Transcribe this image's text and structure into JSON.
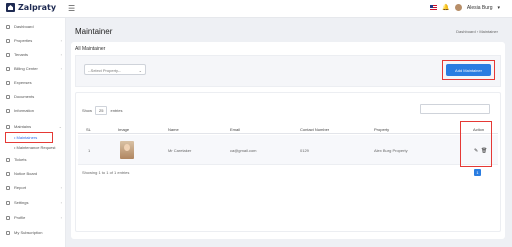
{
  "app": {
    "name": "Zalpraty"
  },
  "topbar": {
    "menu_icon": "hamburger-icon",
    "user": "Alesia Burg",
    "dropdown": "▾"
  },
  "sidebar": {
    "items": [
      {
        "label": "Dashboard",
        "icon": "dashboard-icon"
      },
      {
        "label": "Properties",
        "icon": "building-icon",
        "chevron": "›"
      },
      {
        "label": "Tenants",
        "icon": "users-icon",
        "chevron": "›"
      },
      {
        "label": "Billing Center",
        "icon": "billing-icon",
        "chevron": "›"
      },
      {
        "label": "Expenses",
        "icon": "wallet-icon"
      },
      {
        "label": "Documents",
        "icon": "document-icon"
      },
      {
        "label": "Information",
        "icon": "info-icon"
      },
      {
        "label": "Maintains",
        "icon": "wrench-icon",
        "chevron": "⌄"
      },
      {
        "label": "Tickets",
        "icon": "ticket-icon"
      },
      {
        "label": "Notice Board",
        "icon": "notice-icon"
      },
      {
        "label": "Report",
        "icon": "report-icon",
        "chevron": "›"
      },
      {
        "label": "Settings",
        "icon": "gear-icon",
        "chevron": "›"
      },
      {
        "label": "Profile",
        "icon": "profile-icon",
        "chevron": "›"
      },
      {
        "label": "My Subscription",
        "icon": "subscription-icon"
      }
    ],
    "sub_items": [
      "• Maintainers",
      "• Maintenance Request"
    ]
  },
  "page": {
    "title": "Maintainer",
    "breadcrumb_home": "Dashboard",
    "breadcrumb_sep": "›",
    "breadcrumb_current": "Maintainer"
  },
  "card": {
    "title": "All Maintainer",
    "select_placeholder": "--Select Property--",
    "select_chevron": "⌄",
    "add_button": "Add Maintainer"
  },
  "table": {
    "show_label": "Show",
    "show_value": "25",
    "show_suffix": "entries",
    "headers": [
      "SL",
      "Image",
      "Name",
      "Email",
      "Contact Number",
      "Property",
      "Action"
    ],
    "rows": [
      {
        "sl": "1",
        "name": "Mr Caretaker",
        "email": "ca@gmail.com",
        "contact": "0129",
        "property": "Alex Burg Property",
        "edit": "✎",
        "delete": "🗑"
      }
    ],
    "footer": "Showing 1 to 1 of 1 entries",
    "page": "1"
  },
  "colors": {
    "accent": "#2a7de1",
    "highlight": "#e53935",
    "brand": "#1e2a52"
  }
}
